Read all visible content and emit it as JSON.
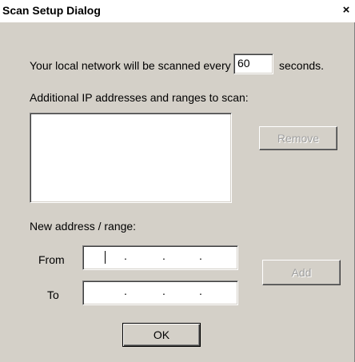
{
  "window": {
    "title": "Scan Setup Dialog",
    "close_glyph": "×"
  },
  "scan": {
    "prefix": "Your local network will be scanned every",
    "interval_value": "60",
    "suffix": "seconds."
  },
  "additional": {
    "label": "Additional IP addresses and ranges to scan:",
    "items": [],
    "remove_label": "Remove"
  },
  "new_range": {
    "label": "New address / range:",
    "from_label": "From",
    "to_label": "To",
    "dot": ".",
    "add_label": "Add"
  },
  "ok_label": "OK",
  "colors": {
    "dialog_bg": "#d4d0c8",
    "disabled_text": "#a0a0a0"
  },
  "icons": {
    "close": "close-icon"
  }
}
